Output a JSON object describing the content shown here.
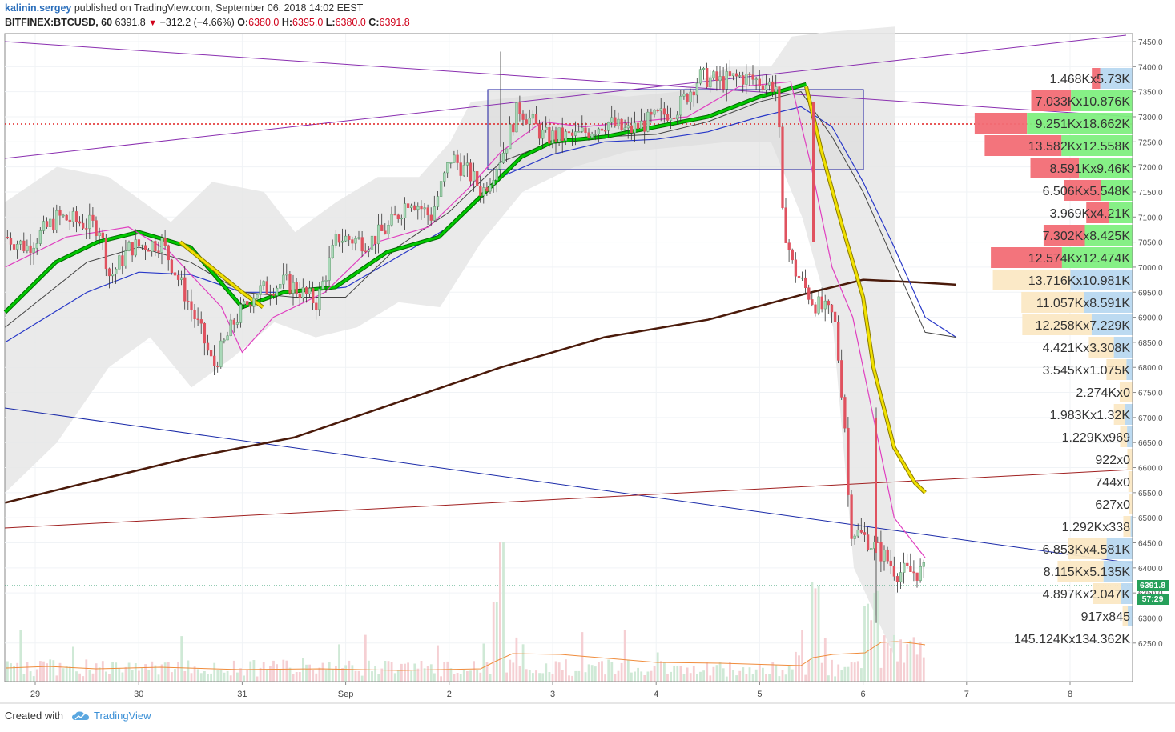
{
  "header": {
    "author": "kalinin.sergey",
    "published_text": "published on TradingView.com, September 06, 2018 14:02 EEST",
    "symbol": "BITFINEX:BTCUSD, 60",
    "last": "6391.8",
    "change_arrow": "▼",
    "change": "−312.2 (−4.66%)",
    "o_label": "O:",
    "o_val": "6380.0",
    "h_label": "H:",
    "h_val": "6395.0",
    "l_label": "L:",
    "l_val": "6380.0",
    "c_label": "C:",
    "c_val": "6391.8"
  },
  "footer": {
    "created_with": "Created with",
    "brand": "TradingView"
  },
  "price_tags": {
    "last_price": "6391.8",
    "countdown": "57:29"
  },
  "colors": {
    "up_candle": "#a9d8b8",
    "down_candle": "#e0525f",
    "ema_green": "#00c800",
    "ema_yellow": "#f0e000",
    "ma_brown": "#4a1a0a",
    "blue_line": "#2838c8",
    "purple_line": "#8a2fb0",
    "pink_line": "#e040c0",
    "dotted_red": "#e02020",
    "vp_red": "#f26d75",
    "vp_green": "#7fef7f",
    "vp_orange": "#fbe8c4",
    "vp_blue": "#b8d8f0"
  },
  "chart_data": {
    "type": "candlestick",
    "symbol": "BITFINEX:BTCUSD",
    "interval": "60",
    "x_ticks": [
      "29",
      "30",
      "31",
      "Sep",
      "2",
      "3",
      "4",
      "5",
      "6",
      "7",
      "8"
    ],
    "y_ticks": [
      "7450.0",
      "7400.0",
      "7350.0",
      "7300.0",
      "7250.0",
      "7200.0",
      "7150.0",
      "7100.0",
      "7050.0",
      "7000.0",
      "6950.0",
      "6900.0",
      "6850.0",
      "6800.0",
      "6750.0",
      "6700.0",
      "6650.0",
      "6600.0",
      "6550.0",
      "6500.0",
      "6450.0",
      "6400.0",
      "6350.0",
      "6300.0",
      "6250.0"
    ],
    "ylim": [
      6200,
      7480
    ],
    "last_price": 6391.8,
    "price_path": [
      [
        0,
        7060
      ],
      [
        0.2,
        7040
      ],
      [
        0.5,
        7100
      ],
      [
        0.9,
        7080
      ],
      [
        1.0,
        6980
      ],
      [
        1.2,
        7040
      ],
      [
        1.5,
        7050
      ],
      [
        1.7,
        6960
      ],
      [
        1.9,
        6860
      ],
      [
        2.0,
        6800
      ],
      [
        2.2,
        6890
      ],
      [
        2.4,
        6950
      ],
      [
        2.7,
        6970
      ],
      [
        3.0,
        6930
      ],
      [
        3.2,
        7060
      ],
      [
        3.5,
        7050
      ],
      [
        3.7,
        7080
      ],
      [
        3.9,
        7140
      ],
      [
        4.1,
        7100
      ],
      [
        4.3,
        7220
      ],
      [
        4.5,
        7180
      ],
      [
        4.6,
        7150
      ],
      [
        4.8,
        7230
      ],
      [
        4.95,
        7320
      ],
      [
        5.2,
        7260
      ],
      [
        5.5,
        7260
      ],
      [
        5.8,
        7290
      ],
      [
        6.0,
        7270
      ],
      [
        6.3,
        7300
      ],
      [
        6.5,
        7320
      ],
      [
        6.7,
        7380
      ],
      [
        6.9,
        7370
      ],
      [
        7.1,
        7380
      ],
      [
        7.3,
        7370
      ],
      [
        7.45,
        7360
      ],
      [
        7.5,
        7100
      ],
      [
        7.6,
        7000
      ],
      [
        7.8,
        6930
      ],
      [
        8.0,
        6900
      ],
      [
        8.1,
        6700
      ],
      [
        8.15,
        6480
      ],
      [
        8.3,
        6460
      ],
      [
        8.5,
        6420
      ],
      [
        8.6,
        6391.8
      ]
    ],
    "volume_profile": [
      {
        "price": 7400,
        "label": "1.468Kx5.73K",
        "sell": 1.468,
        "buy": 5.73
      },
      {
        "price": 7355,
        "label": "7.033Kx10.876K",
        "sell": 7.033,
        "buy": 10.876
      },
      {
        "price": 7310,
        "label": "9.251Kx18.662K",
        "sell": 9.251,
        "buy": 18.662
      },
      {
        "price": 7265,
        "label": "13.582Kx12.558K",
        "sell": 13.582,
        "buy": 12.558
      },
      {
        "price": 7220,
        "label": "8.591Kx9.46K",
        "sell": 8.591,
        "buy": 9.46
      },
      {
        "price": 7175,
        "label": "6.506Kx5.548K",
        "sell": 6.506,
        "buy": 5.548
      },
      {
        "price": 7130,
        "label": "3.969Kx4.21K",
        "sell": 3.969,
        "buy": 4.21
      },
      {
        "price": 7085,
        "label": "7.302Kx8.425K",
        "sell": 7.302,
        "buy": 8.425
      },
      {
        "price": 7040,
        "label": "12.574Kx12.474K",
        "sell": 12.574,
        "buy": 12.474
      },
      {
        "price": 6995,
        "label": "13.716Kx10.981K",
        "sell": 13.716,
        "buy": 10.981
      },
      {
        "price": 6950,
        "label": "11.057Kx8.591K",
        "sell": 11.057,
        "buy": 8.591
      },
      {
        "price": 6905,
        "label": "12.258Kx7.229K",
        "sell": 12.258,
        "buy": 7.229
      },
      {
        "price": 6860,
        "label": "4.421Kx3.308K",
        "sell": 4.421,
        "buy": 3.308
      },
      {
        "price": 6815,
        "label": "3.545Kx1.075K",
        "sell": 3.545,
        "buy": 1.075
      },
      {
        "price": 6770,
        "label": "2.274Kx0",
        "sell": 2.274,
        "buy": 0
      },
      {
        "price": 6725,
        "label": "1.983Kx1.32K",
        "sell": 1.983,
        "buy": 1.32
      },
      {
        "price": 6680,
        "label": "1.229Kx969",
        "sell": 1.229,
        "buy": 0.969
      },
      {
        "price": 6635,
        "label": "922x0",
        "sell": 0.922,
        "buy": 0
      },
      {
        "price": 6590,
        "label": "744x0",
        "sell": 0.744,
        "buy": 0
      },
      {
        "price": 6545,
        "label": "627x0",
        "sell": 0.627,
        "buy": 0
      },
      {
        "price": 6500,
        "label": "1.292Kx338",
        "sell": 1.292,
        "buy": 0.338
      },
      {
        "price": 6455,
        "label": "6.853Kx4.581K",
        "sell": 6.853,
        "buy": 4.581
      },
      {
        "price": 6410,
        "label": "8.115Kx5.135K",
        "sell": 8.115,
        "buy": 5.135
      },
      {
        "price": 6365,
        "label": "4.897Kx2.047K",
        "sell": 4.897,
        "buy": 2.047
      },
      {
        "price": 6320,
        "label": "917x845",
        "sell": 0.917,
        "buy": 0.845
      },
      {
        "price": 6275,
        "label": "145.124Kx134.362K",
        "sell": 0,
        "buy": 0
      }
    ]
  }
}
